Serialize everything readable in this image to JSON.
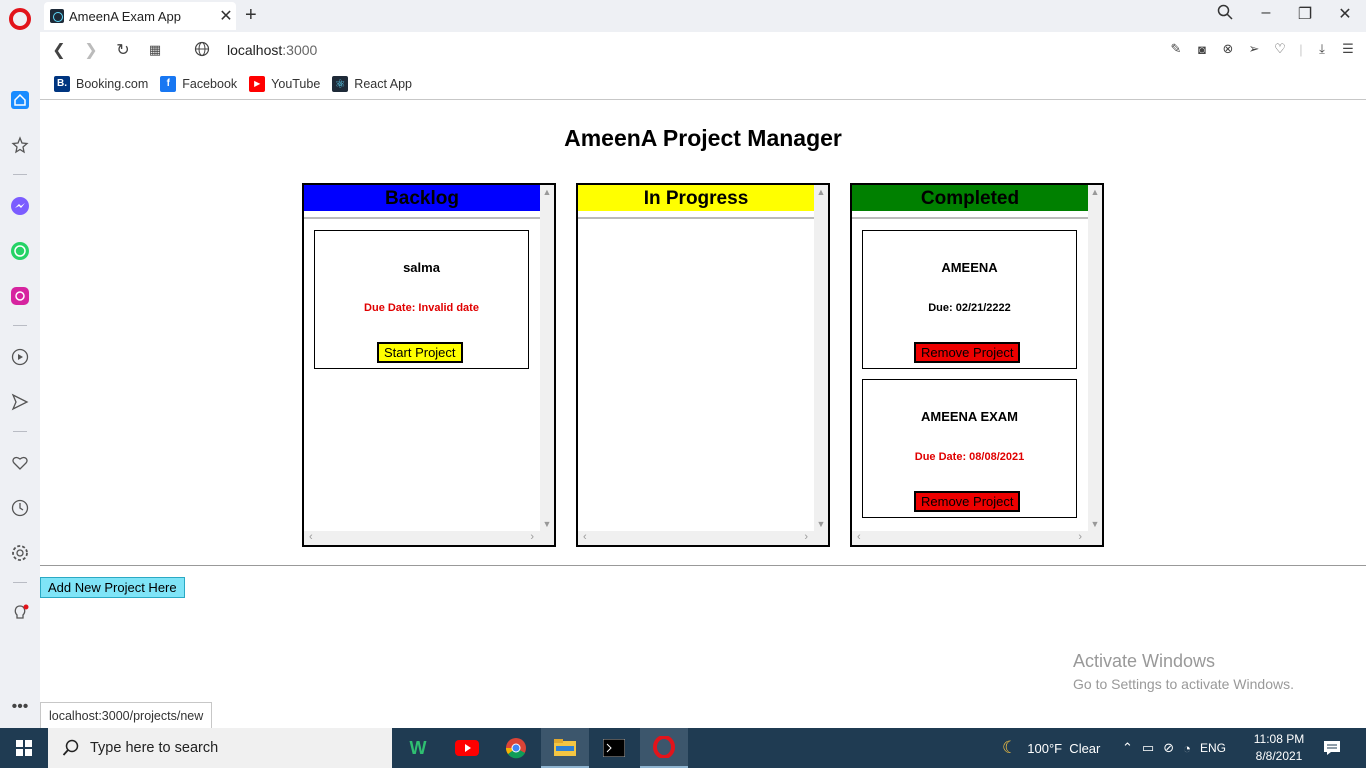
{
  "browser": {
    "tab_title": "AmeenA Exam App",
    "url_host": "localhost",
    "url_port": ":3000",
    "status_url": "localhost:3000/projects/new"
  },
  "bookmarks": [
    {
      "label": "Booking.com",
      "icon": "booking-icon",
      "color": "#003580",
      "glyph": "B."
    },
    {
      "label": "Facebook",
      "icon": "facebook-icon",
      "color": "#1877f2",
      "glyph": "f"
    },
    {
      "label": "YouTube",
      "icon": "youtube-icon",
      "color": "#ff0000",
      "glyph": "▶"
    },
    {
      "label": "React App",
      "icon": "react-icon",
      "color": "#1e2a38",
      "glyph": "⚛"
    }
  ],
  "app": {
    "title": "AmeenA Project Manager",
    "add_button": "Add New Project Here"
  },
  "boards": {
    "backlog": {
      "title": "Backlog",
      "color": "#0000ff",
      "cards": [
        {
          "name": "salma",
          "due": "Due Date: Invalid date",
          "due_color": "#e00000",
          "button": "Start Project",
          "button_color": "#ffff00"
        }
      ]
    },
    "in_progress": {
      "title": "In Progress",
      "color": "#ffff00",
      "cards": []
    },
    "completed": {
      "title": "Completed",
      "color": "#008000",
      "cards": [
        {
          "name": "AMEENA",
          "due": "Due: 02/21/2222",
          "due_color": "#000000",
          "button": "Remove Project",
          "button_color": "#ee0000"
        },
        {
          "name": "AMEENA EXAM",
          "due": "Due Date: 08/08/2021",
          "due_color": "#e00000",
          "button": "Remove Project",
          "button_color": "#ee0000"
        }
      ]
    }
  },
  "watermark": {
    "line1": "Activate Windows",
    "line2": "Go to Settings to activate Windows."
  },
  "taskbar": {
    "search_placeholder": "Type here to search",
    "weather": "100°F  Clear",
    "language": "ENG",
    "time": "11:08 PM",
    "date": "8/8/2021"
  }
}
